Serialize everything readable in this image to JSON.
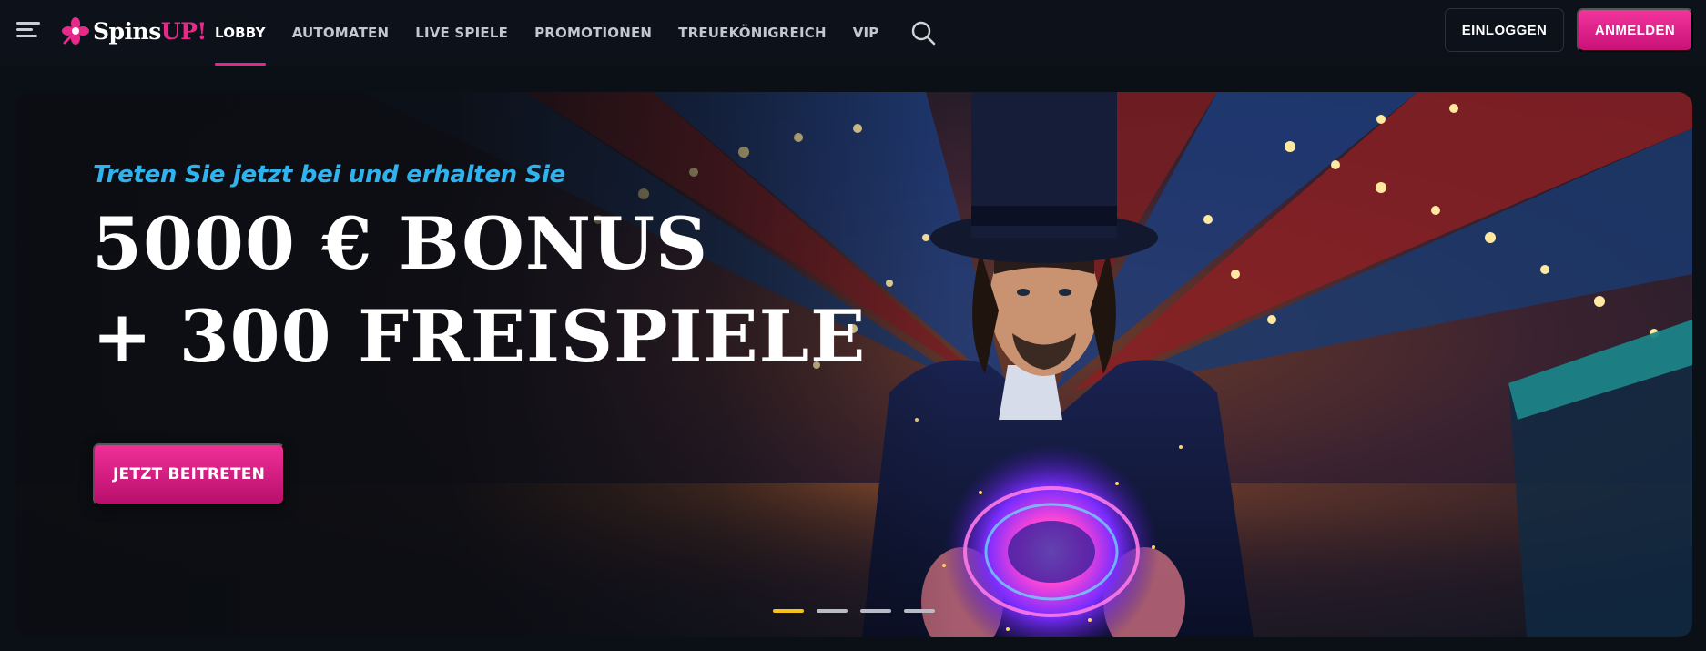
{
  "brand": {
    "name_white": "Spins",
    "name_pink": "UP!",
    "accent_pink": "#e7298a",
    "accent_blue": "#2fb3ee",
    "accent_gold": "#f6c21a"
  },
  "header": {
    "menu_icon": "hamburger-icon",
    "nav": [
      {
        "label": "LOBBY",
        "active": true
      },
      {
        "label": "AUTOMATEN",
        "active": false
      },
      {
        "label": "LIVE SPIELE",
        "active": false
      },
      {
        "label": "PROMOTIONEN",
        "active": false
      },
      {
        "label": "TREUEKÖNIGREICH",
        "active": false
      },
      {
        "label": "VIP",
        "active": false
      }
    ],
    "search_icon": "search-icon",
    "login_label": "EINLOGGEN",
    "register_label": "ANMELDEN"
  },
  "hero": {
    "subtitle": "Treten Sie jetzt bei und erhalten Sie",
    "title_line1": "5000 € BONUS",
    "title_line2": "+ 300 FREISPIELE",
    "cta_label": "JETZT BEITRETEN",
    "image": "magician-holding-glowing-orb-in-circus-tent",
    "slides_total": 4,
    "slide_active": 1
  }
}
